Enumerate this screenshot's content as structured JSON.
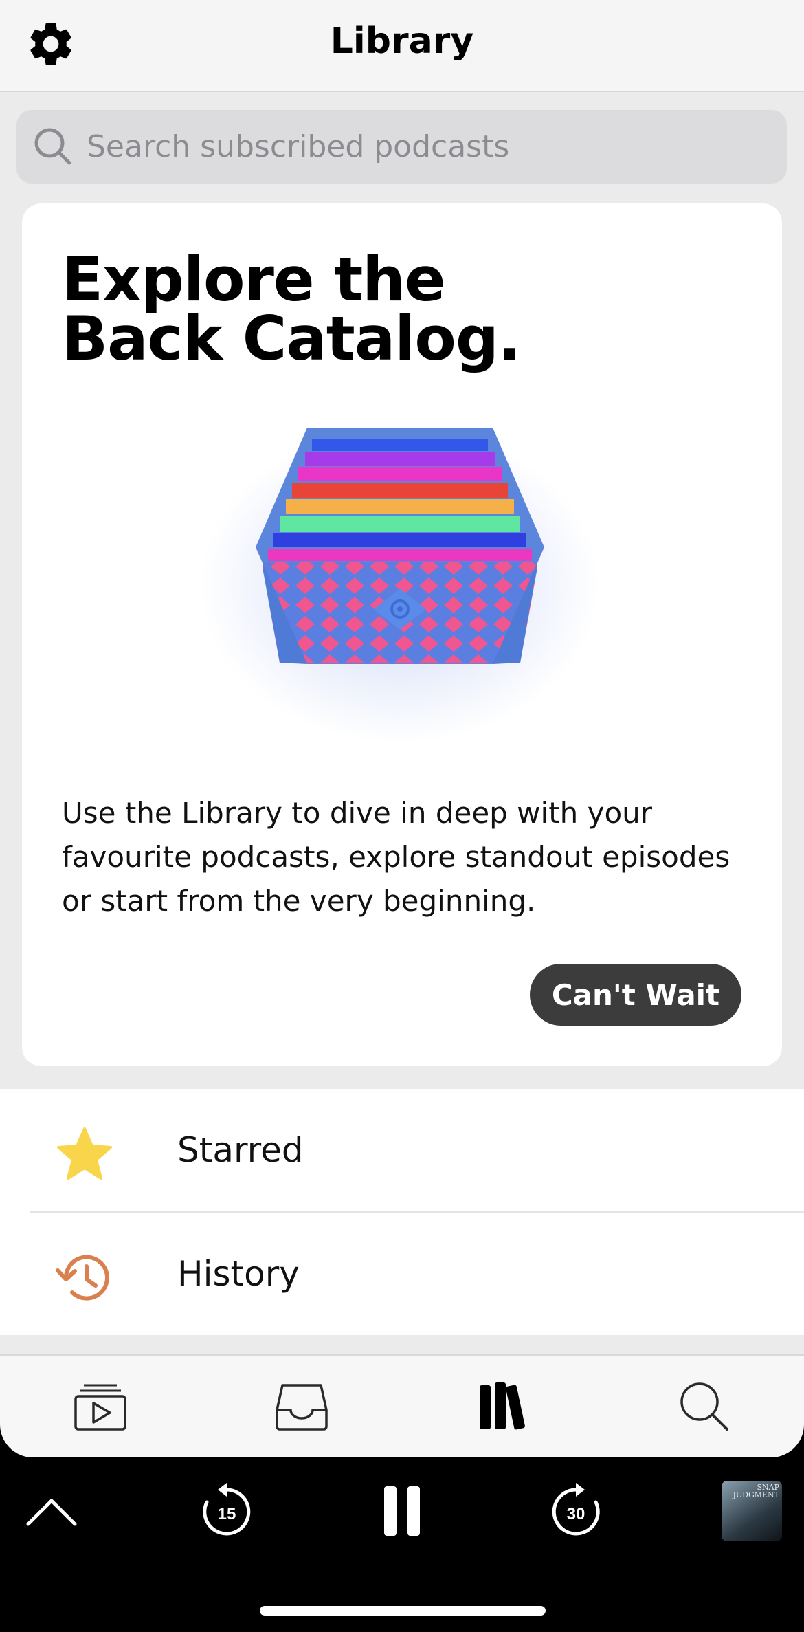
{
  "header": {
    "title": "Library",
    "settings_icon": "gear-icon"
  },
  "search": {
    "placeholder": "Search subscribed podcasts",
    "icon": "search-icon"
  },
  "promo": {
    "title_lines": [
      "Explore the",
      "Back Catalog."
    ],
    "body_lines": [
      "Use the Library to dive in deep with your",
      "favourite podcasts, explore standout episodes",
      "or start from the very beginning."
    ],
    "cta_label": "Can't Wait",
    "illustration": "podcast-crate-illustration"
  },
  "library_items": [
    {
      "label": "Starred",
      "icon": "star-icon",
      "color": "#f8d54a"
    },
    {
      "label": "History",
      "icon": "history-icon",
      "color": "#d9804e"
    }
  ],
  "tab_bar": {
    "tabs": [
      {
        "name": "up-next",
        "icon": "play-stack-icon",
        "active": false
      },
      {
        "name": "inbox",
        "icon": "inbox-icon",
        "active": false
      },
      {
        "name": "library",
        "icon": "library-icon",
        "active": true
      },
      {
        "name": "search",
        "icon": "search-icon",
        "active": false
      }
    ]
  },
  "player": {
    "skip_back_seconds": "15",
    "skip_forward_seconds": "30",
    "state": "playing",
    "artwork_text": [
      "SNAP",
      "JUDGMENT"
    ]
  },
  "colors": {
    "accent_star": "#f8d54a",
    "accent_history": "#d9804e",
    "cta_background": "#3c3c3c",
    "player_background": "#000000"
  }
}
